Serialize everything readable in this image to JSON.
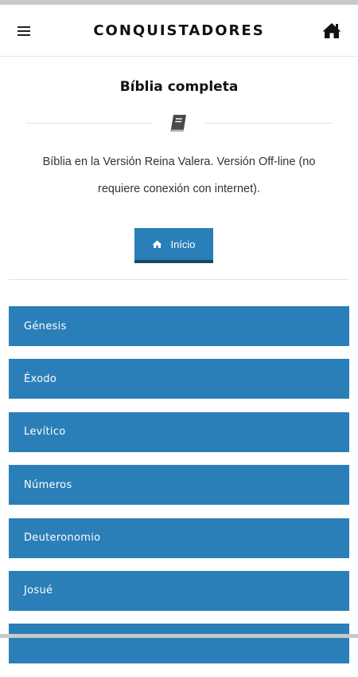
{
  "header": {
    "title": "CONQUISTADORES",
    "menu_icon": "hamburger-menu-icon",
    "home_icon": "home-icon"
  },
  "section": {
    "title": "Bíblia completa",
    "divider_icon": "book-icon",
    "description": "Bíblia en la Versión Reina Valera. Versión Off-line (no requiere conexión con internet)."
  },
  "inicio_button": {
    "label": "Início",
    "icon": "home-icon"
  },
  "books": [
    {
      "label": "Génesis"
    },
    {
      "label": "Éxodo"
    },
    {
      "label": "Levítico"
    },
    {
      "label": "Números"
    },
    {
      "label": "Deuteronomio"
    },
    {
      "label": "Josué"
    },
    {
      "label": ""
    }
  ],
  "colors": {
    "primary": "#2a7fb8",
    "primary_dark": "#17476a",
    "battery": "#38d35a"
  }
}
